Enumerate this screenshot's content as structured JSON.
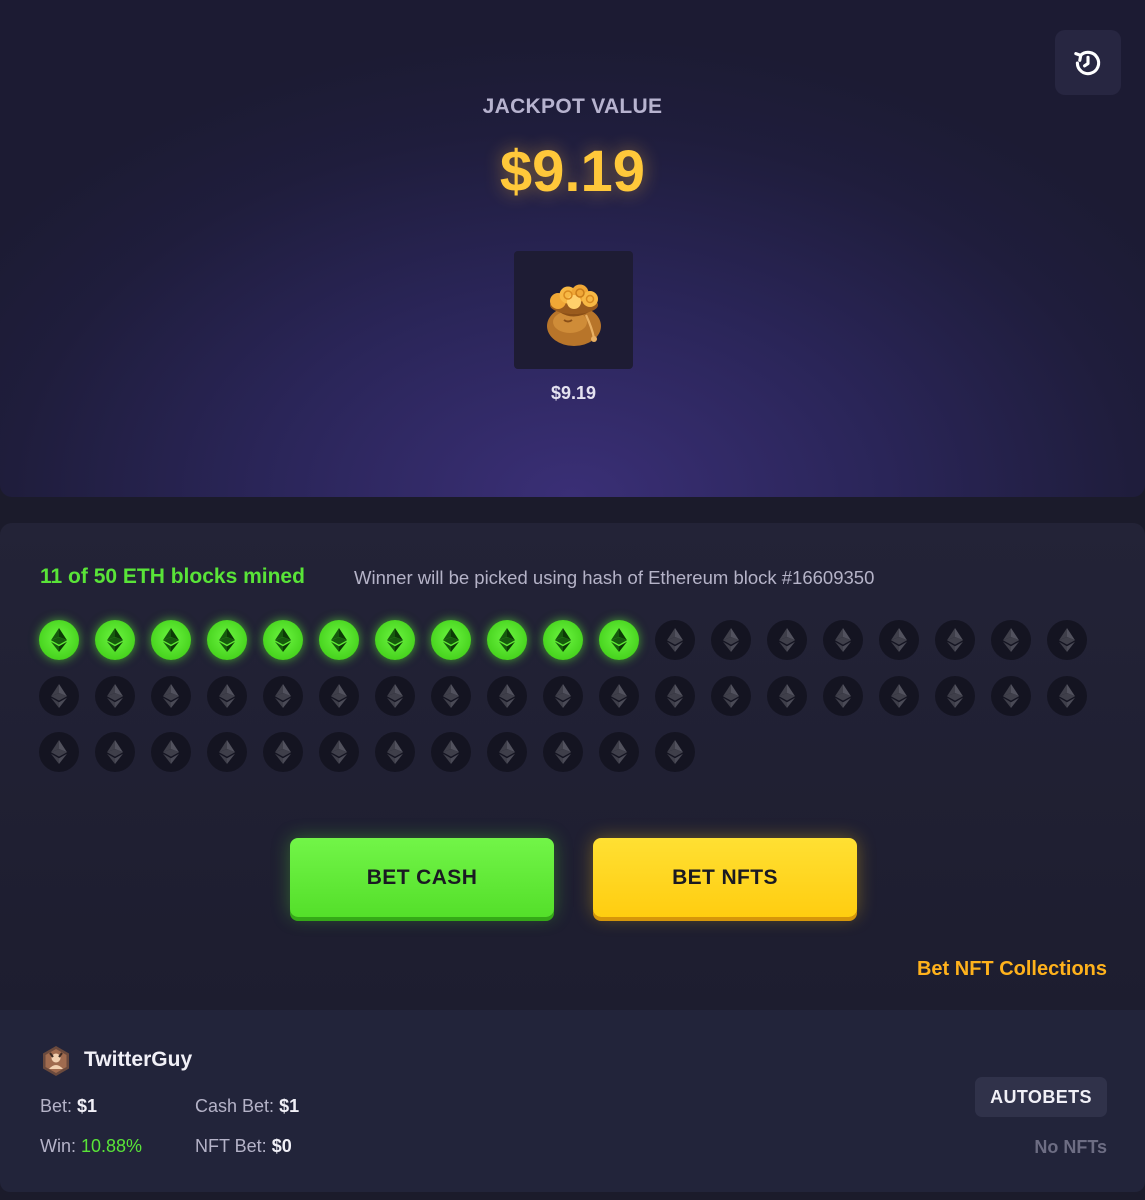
{
  "jackpot": {
    "label": "JACKPOT VALUE",
    "value": "$9.19",
    "item_price": "$9.19"
  },
  "blocks": {
    "status": "11 of 50 ETH blocks mined",
    "info": "Winner will be picked using hash of Ethereum block #16609350",
    "mined": 11,
    "total": 50
  },
  "actions": {
    "bet_cash": "BET CASH",
    "bet_nfts": "BET NFTS",
    "nft_collections": "Bet NFT Collections"
  },
  "player": {
    "username": "TwitterGuy",
    "bet_label": "Bet:",
    "bet_value": "$1",
    "cash_bet_label": "Cash Bet:",
    "cash_bet_value": "$1",
    "win_label": "Win:",
    "win_value": "10.88%",
    "nft_bet_label": "NFT Bet:",
    "nft_bet_value": "$0",
    "autobets": "AUTOBETS",
    "no_nfts": "No NFTs"
  },
  "colors": {
    "accent_green": "#59e438",
    "accent_yellow": "#ffc83a",
    "accent_orange": "#ffb21c",
    "background": "#1b1b2b"
  },
  "icons": {
    "history": "history-icon",
    "block": "ethereum-icon",
    "item": "money-bag-icon",
    "avatar": "user-avatar-icon"
  }
}
